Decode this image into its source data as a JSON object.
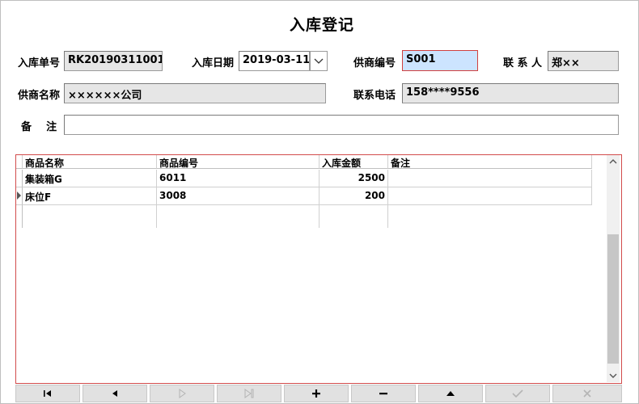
{
  "title": "入库登记",
  "form": {
    "order_no_label": "入库单号",
    "order_no": "RK20190311001",
    "date_label": "入库日期",
    "date": "2019-03-11",
    "supplier_code_label": "供商编号",
    "supplier_code": "S001",
    "contact_label": "联 系 人",
    "contact": "郑××",
    "supplier_name_label": "供商名称",
    "supplier_name": "××××××公司",
    "phone_label": "联系电话",
    "phone": "158****9556",
    "remark_label": "备    注",
    "remark": ""
  },
  "grid": {
    "columns": [
      "商品名称",
      "商品编号",
      "入库金额",
      "备注"
    ],
    "rows": [
      {
        "name": "集装箱G",
        "code": "6011",
        "amount": "2500",
        "note": ""
      },
      {
        "name": "床位F",
        "code": "3008",
        "amount": "200",
        "note": ""
      }
    ]
  },
  "nav": [
    {
      "name": "first-record",
      "icon": "first-icon",
      "enabled": true
    },
    {
      "name": "prev-record",
      "icon": "prev-icon",
      "enabled": true
    },
    {
      "name": "next-record",
      "icon": "next-icon",
      "enabled": false
    },
    {
      "name": "last-record",
      "icon": "last-icon",
      "enabled": false
    },
    {
      "name": "add-record",
      "icon": "plus-icon",
      "enabled": true
    },
    {
      "name": "delete-record",
      "icon": "minus-icon",
      "enabled": true
    },
    {
      "name": "edit-record",
      "icon": "up-icon",
      "enabled": true
    },
    {
      "name": "post-edit",
      "icon": "check-icon",
      "enabled": false
    },
    {
      "name": "cancel-edit",
      "icon": "cross-icon",
      "enabled": false
    }
  ],
  "colors": {
    "highlight_border": "#d24b4b",
    "selected_field": "#cce4ff",
    "readonly_field": "#e6e6e6",
    "enabled_icon": "#000000",
    "disabled_icon": "#b4b4b4"
  }
}
